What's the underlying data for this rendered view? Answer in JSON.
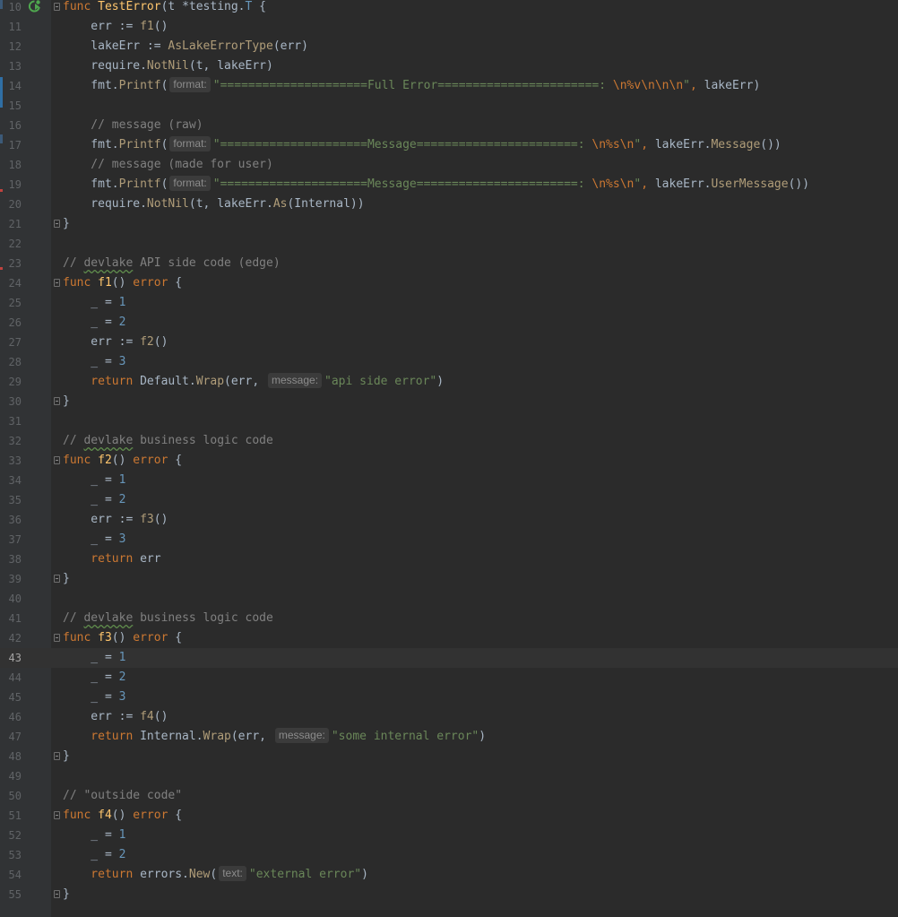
{
  "editor": {
    "language": "Go",
    "current_line": "43",
    "colors": {
      "background": "#2b2b2b",
      "gutter": "#313335",
      "keyword": "#cc7832",
      "function_decl": "#ffc66d",
      "string": "#6a8759",
      "number": "#6897bb",
      "comment": "#808080",
      "run_icon": "#4fa74f"
    },
    "gutter_icons": [
      "run-test-icon",
      "fold-icon"
    ],
    "lines": [
      {
        "n": "10",
        "t": [
          [
            "kw",
            "func "
          ],
          [
            "fn",
            "TestError"
          ],
          [
            "",
            "(t *testing."
          ],
          [
            "ty",
            "T"
          ],
          [
            "",
            " {"
          ]
        ]
      },
      {
        "n": "11",
        "t": [
          [
            "",
            "    err := "
          ],
          [
            "call",
            "f1"
          ],
          [
            "",
            "()"
          ]
        ]
      },
      {
        "n": "12",
        "t": [
          [
            "",
            "    lakeErr := "
          ],
          [
            "call",
            "AsLakeErrorType"
          ],
          [
            "",
            "(err)"
          ]
        ]
      },
      {
        "n": "13",
        "t": [
          [
            "",
            "    require."
          ],
          [
            "call",
            "NotNil"
          ],
          [
            "",
            "(t, lakeErr)"
          ]
        ]
      },
      {
        "n": "14",
        "t": [
          [
            "",
            "    fmt."
          ],
          [
            "call",
            "Printf"
          ],
          [
            "",
            "("
          ],
          [
            "hint",
            "format:"
          ],
          [
            "str",
            "\"=====================Full Error=======================: "
          ],
          [
            "esc",
            "\\n%v\\n\\n\\n"
          ],
          [
            "str",
            "\""
          ],
          [
            "kw",
            ","
          ],
          [
            "",
            " lakeErr)"
          ]
        ]
      },
      {
        "n": "15",
        "t": []
      },
      {
        "n": "16",
        "t": [
          [
            "cmt",
            "    // message (raw)"
          ]
        ]
      },
      {
        "n": "17",
        "t": [
          [
            "",
            "    fmt."
          ],
          [
            "call",
            "Printf"
          ],
          [
            "",
            "("
          ],
          [
            "hint",
            "format:"
          ],
          [
            "str",
            "\"=====================Message=======================: "
          ],
          [
            "esc",
            "\\n%s\\n"
          ],
          [
            "str",
            "\""
          ],
          [
            "kw",
            ","
          ],
          [
            "",
            " lakeErr."
          ],
          [
            "call",
            "Message"
          ],
          [
            "",
            "())"
          ]
        ]
      },
      {
        "n": "18",
        "t": [
          [
            "cmt",
            "    // message (made for user)"
          ]
        ]
      },
      {
        "n": "19",
        "t": [
          [
            "",
            "    fmt."
          ],
          [
            "call",
            "Printf"
          ],
          [
            "",
            "("
          ],
          [
            "hint",
            "format:"
          ],
          [
            "str",
            "\"=====================Message=======================: "
          ],
          [
            "esc",
            "\\n%s\\n"
          ],
          [
            "str",
            "\""
          ],
          [
            "kw",
            ","
          ],
          [
            "",
            " lakeErr."
          ],
          [
            "call",
            "UserMessage"
          ],
          [
            "",
            "())"
          ]
        ]
      },
      {
        "n": "20",
        "t": [
          [
            "",
            "    require."
          ],
          [
            "call",
            "NotNil"
          ],
          [
            "",
            "(t, lakeErr."
          ],
          [
            "call",
            "As"
          ],
          [
            "",
            "(Internal))"
          ]
        ]
      },
      {
        "n": "21",
        "t": [
          [
            "",
            "}"
          ]
        ]
      },
      {
        "n": "22",
        "t": []
      },
      {
        "n": "23",
        "t": [
          [
            "cmt",
            "// "
          ],
          [
            "cmtw",
            "devlake"
          ],
          [
            "cmt",
            " API side code (edge)"
          ]
        ]
      },
      {
        "n": "24",
        "t": [
          [
            "kw",
            "func "
          ],
          [
            "fn",
            "f1"
          ],
          [
            "",
            "() "
          ],
          [
            "kw",
            "error"
          ],
          [
            "",
            " {"
          ]
        ]
      },
      {
        "n": "25",
        "t": [
          [
            "",
            "    _ = "
          ],
          [
            "num",
            "1"
          ]
        ]
      },
      {
        "n": "26",
        "t": [
          [
            "",
            "    _ = "
          ],
          [
            "num",
            "2"
          ]
        ]
      },
      {
        "n": "27",
        "t": [
          [
            "",
            "    err := "
          ],
          [
            "call",
            "f2"
          ],
          [
            "",
            "()"
          ]
        ]
      },
      {
        "n": "28",
        "t": [
          [
            "",
            "    _ = "
          ],
          [
            "num",
            "3"
          ]
        ]
      },
      {
        "n": "29",
        "t": [
          [
            "kw",
            "    return "
          ],
          [
            "",
            "Default."
          ],
          [
            "call",
            "Wrap"
          ],
          [
            "",
            "(err, "
          ],
          [
            "hint",
            "message:"
          ],
          [
            "str",
            "\"api side error\""
          ],
          [
            "",
            ")"
          ]
        ]
      },
      {
        "n": "30",
        "t": [
          [
            "",
            "}"
          ]
        ]
      },
      {
        "n": "31",
        "t": []
      },
      {
        "n": "32",
        "t": [
          [
            "cmt",
            "// "
          ],
          [
            "cmtw",
            "devlake"
          ],
          [
            "cmt",
            " business logic code"
          ]
        ]
      },
      {
        "n": "33",
        "t": [
          [
            "kw",
            "func "
          ],
          [
            "fn",
            "f2"
          ],
          [
            "",
            "() "
          ],
          [
            "kw",
            "error"
          ],
          [
            "",
            " {"
          ]
        ]
      },
      {
        "n": "34",
        "t": [
          [
            "",
            "    _ = "
          ],
          [
            "num",
            "1"
          ]
        ]
      },
      {
        "n": "35",
        "t": [
          [
            "",
            "    _ = "
          ],
          [
            "num",
            "2"
          ]
        ]
      },
      {
        "n": "36",
        "t": [
          [
            "",
            "    err := "
          ],
          [
            "call",
            "f3"
          ],
          [
            "",
            "()"
          ]
        ]
      },
      {
        "n": "37",
        "t": [
          [
            "",
            "    _ = "
          ],
          [
            "num",
            "3"
          ]
        ]
      },
      {
        "n": "38",
        "t": [
          [
            "kw",
            "    return "
          ],
          [
            "",
            "err"
          ]
        ]
      },
      {
        "n": "39",
        "t": [
          [
            "",
            "}"
          ]
        ]
      },
      {
        "n": "40",
        "t": []
      },
      {
        "n": "41",
        "t": [
          [
            "cmt",
            "// "
          ],
          [
            "cmtw",
            "devlake"
          ],
          [
            "cmt",
            " business logic code"
          ]
        ]
      },
      {
        "n": "42",
        "t": [
          [
            "kw",
            "func "
          ],
          [
            "fn",
            "f3"
          ],
          [
            "",
            "() "
          ],
          [
            "kw",
            "error"
          ],
          [
            "",
            " {"
          ]
        ]
      },
      {
        "n": "43",
        "t": [
          [
            "",
            "    _ = "
          ],
          [
            "num",
            "1"
          ]
        ]
      },
      {
        "n": "44",
        "t": [
          [
            "",
            "    _ = "
          ],
          [
            "num",
            "2"
          ]
        ]
      },
      {
        "n": "45",
        "t": [
          [
            "",
            "    _ = "
          ],
          [
            "num",
            "3"
          ]
        ]
      },
      {
        "n": "46",
        "t": [
          [
            "",
            "    err := "
          ],
          [
            "call",
            "f4"
          ],
          [
            "",
            "()"
          ]
        ]
      },
      {
        "n": "47",
        "t": [
          [
            "kw",
            "    return "
          ],
          [
            "",
            "Internal."
          ],
          [
            "call",
            "Wrap"
          ],
          [
            "",
            "(err, "
          ],
          [
            "hint",
            "message:"
          ],
          [
            "str",
            "\"some internal error\""
          ],
          [
            "",
            ")"
          ]
        ]
      },
      {
        "n": "48",
        "t": [
          [
            "",
            "}"
          ]
        ]
      },
      {
        "n": "49",
        "t": []
      },
      {
        "n": "50",
        "t": [
          [
            "cmt",
            "// \"outside code\""
          ]
        ]
      },
      {
        "n": "51",
        "t": [
          [
            "kw",
            "func "
          ],
          [
            "fn",
            "f4"
          ],
          [
            "",
            "() "
          ],
          [
            "kw",
            "error"
          ],
          [
            "",
            " {"
          ]
        ]
      },
      {
        "n": "52",
        "t": [
          [
            "",
            "    _ = "
          ],
          [
            "num",
            "1"
          ]
        ]
      },
      {
        "n": "53",
        "t": [
          [
            "",
            "    _ = "
          ],
          [
            "num",
            "2"
          ]
        ]
      },
      {
        "n": "54",
        "t": [
          [
            "kw",
            "    return "
          ],
          [
            "",
            "errors."
          ],
          [
            "call",
            "New"
          ],
          [
            "",
            "("
          ],
          [
            "hint",
            "text:"
          ],
          [
            "str",
            "\"external error\""
          ],
          [
            "",
            ")"
          ]
        ]
      },
      {
        "n": "55",
        "t": [
          [
            "",
            "}"
          ]
        ]
      }
    ]
  }
}
